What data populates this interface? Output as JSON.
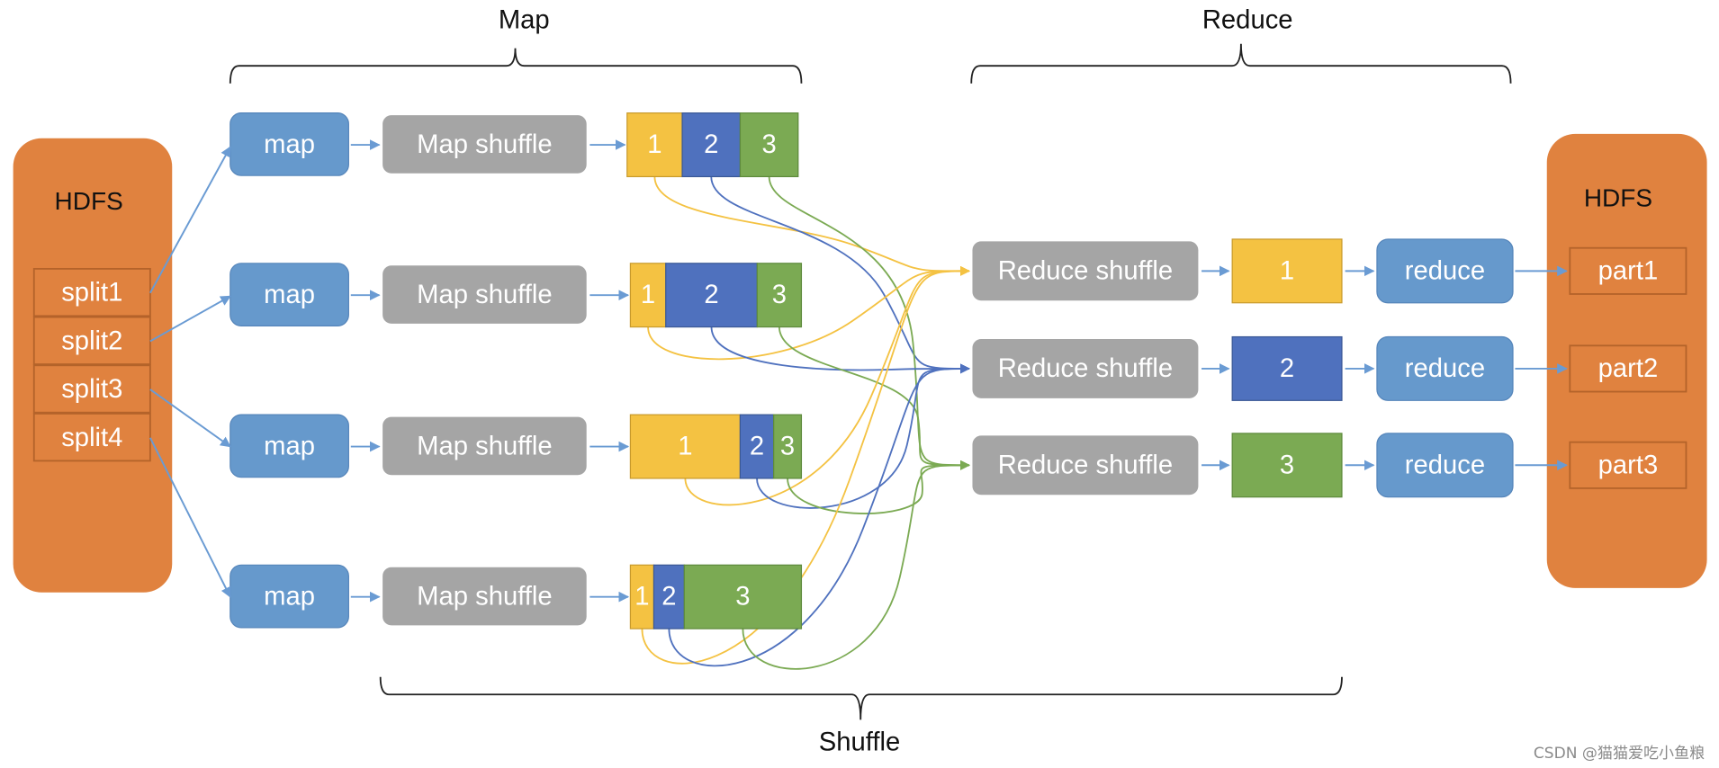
{
  "colors": {
    "hdfs": "#E0823F",
    "hdfs_cell_border": "#B4632A",
    "map": "#6699CC",
    "shuffle": "#A5A5A5",
    "p1": "#F4C242",
    "p2": "#4F71BE",
    "p3": "#7BAA53",
    "arrow": "#6A9BD3",
    "bracket": "#222222"
  },
  "sections": {
    "map": "Map",
    "reduce": "Reduce",
    "shuffle": "Shuffle"
  },
  "input_hdfs": {
    "title": "HDFS",
    "splits": [
      "split1",
      "split2",
      "split3",
      "split4"
    ]
  },
  "map_rows": [
    {
      "map_label": "map",
      "shuffle_label": "Map shuffle",
      "partitions": [
        {
          "label": "1",
          "part": 1,
          "weight": 1
        },
        {
          "label": "2",
          "part": 2,
          "weight": 1.05
        },
        {
          "label": "3",
          "part": 3,
          "weight": 1.05
        }
      ]
    },
    {
      "map_label": "map",
      "shuffle_label": "Map shuffle",
      "partitions": [
        {
          "label": "1",
          "part": 1,
          "weight": 0.6
        },
        {
          "label": "2",
          "part": 2,
          "weight": 1.55
        },
        {
          "label": "3",
          "part": 3,
          "weight": 0.75
        }
      ]
    },
    {
      "map_label": "map",
      "shuffle_label": "Map shuffle",
      "partitions": [
        {
          "label": "1",
          "part": 1,
          "weight": 1.9
        },
        {
          "label": "2",
          "part": 2,
          "weight": 0.58
        },
        {
          "label": "3",
          "part": 3,
          "weight": 0.48
        }
      ]
    },
    {
      "map_label": "map",
      "shuffle_label": "Map shuffle",
      "partitions": [
        {
          "label": "1",
          "part": 1,
          "weight": 0.4
        },
        {
          "label": "2",
          "part": 2,
          "weight": 0.52
        },
        {
          "label": "3",
          "part": 3,
          "weight": 2.0
        }
      ]
    }
  ],
  "reduce_rows": [
    {
      "shuffle_label": "Reduce shuffle",
      "partition": "1",
      "part": 1,
      "reduce_label": "reduce",
      "output": "part1"
    },
    {
      "shuffle_label": "Reduce shuffle",
      "partition": "2",
      "part": 2,
      "reduce_label": "reduce",
      "output": "part2"
    },
    {
      "shuffle_label": "Reduce shuffle",
      "partition": "3",
      "part": 3,
      "reduce_label": "reduce",
      "output": "part3"
    }
  ],
  "output_hdfs": {
    "title": "HDFS"
  },
  "watermark": "CSDN @猫猫爱吃小鱼粮"
}
